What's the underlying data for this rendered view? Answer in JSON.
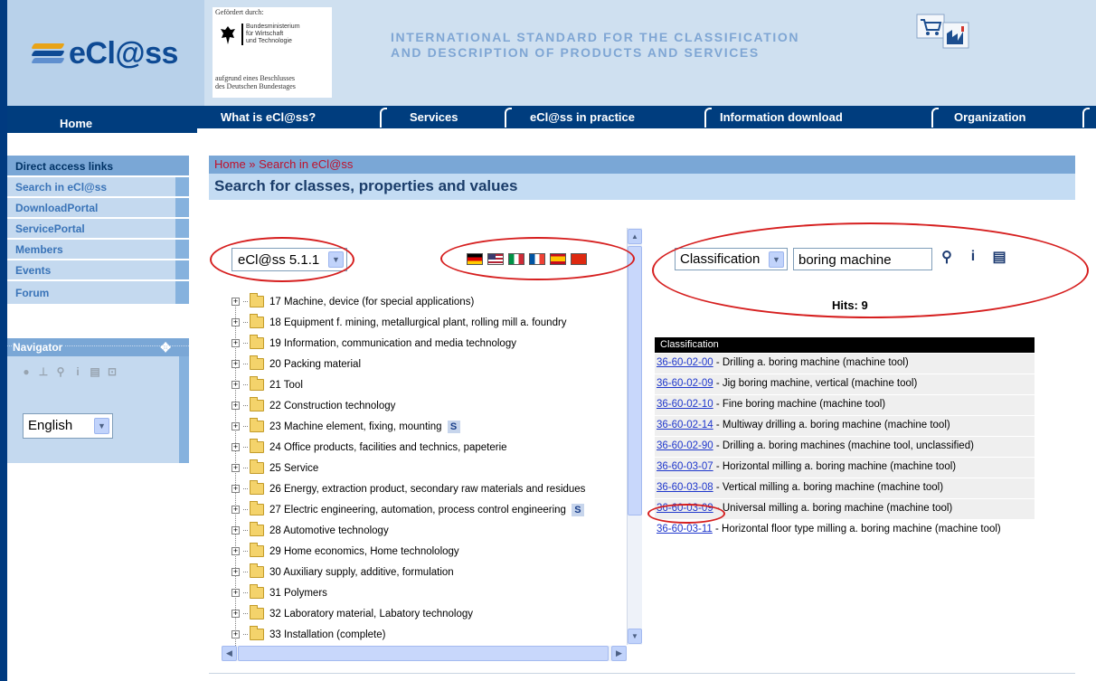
{
  "colors": {
    "nav": "#003d7e",
    "sidebar": "#c4d9ef",
    "accent": "#7aa7d6",
    "link": "#1f37cc",
    "annotation": "#d61f1f"
  },
  "header": {
    "logo": "eCl@ss",
    "sponsor": {
      "top": "Gefördert durch:",
      "ministry": [
        "Bundesministerium",
        "für Wirtschaft",
        "und Technologie"
      ],
      "bottom": [
        "aufgrund eines Beschlusses",
        "des Deutschen Bundestages"
      ]
    },
    "tagline": [
      "INTERNATIONAL STANDARD FOR THE CLASSIFICATION",
      "AND DESCRIPTION OF PRODUCTS AND SERVICES"
    ],
    "cart_icon": "shopping-cart-icon"
  },
  "nav": {
    "home": "Home",
    "items": [
      "What is eCl@ss?",
      "Services",
      "eCl@ss in practice",
      "Information download",
      "Organization"
    ]
  },
  "sidebar": {
    "heading": "Direct access links",
    "items": [
      "Search in eCl@ss",
      "DownloadPortal",
      "ServicePortal",
      "Members",
      "Events",
      "Forum"
    ],
    "navigator": {
      "title": "Navigator",
      "icons": [
        "user-icon",
        "hierarchy-icon",
        "search-icon",
        "info-icon",
        "print-icon",
        "export-icon"
      ],
      "language": "English"
    }
  },
  "main": {
    "breadcrumb": "Home » Search in eCl@ss",
    "title": "Search for classes, properties and values",
    "version": "eCl@ss 5.1.1",
    "flags": [
      "de",
      "us",
      "it",
      "fr",
      "es",
      "cn"
    ],
    "tree": [
      {
        "label": "17 Machine, device (for special applications)",
        "badge": ""
      },
      {
        "label": "18 Equipment f. mining, metallurgical plant, rolling mill a. foundry",
        "badge": ""
      },
      {
        "label": "19 Information, communication and media technology",
        "badge": ""
      },
      {
        "label": "20 Packing material",
        "badge": ""
      },
      {
        "label": "21 Tool",
        "badge": ""
      },
      {
        "label": "22 Construction technology",
        "badge": ""
      },
      {
        "label": "23 Machine element, fixing, mounting",
        "badge": "S"
      },
      {
        "label": "24 Office products, facilities and technics, papeterie",
        "badge": ""
      },
      {
        "label": "25 Service",
        "badge": ""
      },
      {
        "label": "26 Energy, extraction product, secondary raw materials and residues",
        "badge": ""
      },
      {
        "label": "27 Electric engineering, automation, process control engineering",
        "badge": "S"
      },
      {
        "label": "28 Automotive technology",
        "badge": ""
      },
      {
        "label": "29 Home economics, Home technolology",
        "badge": ""
      },
      {
        "label": "30 Auxiliary supply, additive, formulation",
        "badge": ""
      },
      {
        "label": "31 Polymers",
        "badge": ""
      },
      {
        "label": "32 Laboratory material, Labatory technology",
        "badge": ""
      },
      {
        "label": "33 Installation (complete)",
        "badge": ""
      }
    ],
    "search": {
      "type": "Classification",
      "query": "boring machine",
      "icons": [
        "search-icon",
        "info-icon",
        "print-icon"
      ]
    },
    "hits": "Hits: 9",
    "results_header": "Classification",
    "results": [
      {
        "code": "36-60-02-00",
        "text": " - Drilling a. boring machine (machine tool)"
      },
      {
        "code": "36-60-02-09",
        "text": " - Jig boring machine, vertical (machine tool)"
      },
      {
        "code": "36-60-02-10",
        "text": " - Fine boring machine (machine tool)"
      },
      {
        "code": "36-60-02-14",
        "text": " - Multiway drilling a. boring machine (machine tool)"
      },
      {
        "code": "36-60-02-90",
        "text": " - Drilling a. boring machines (machine tool, unclassified)"
      },
      {
        "code": "36-60-03-07",
        "text": " - Horizontal milling a. boring machine (machine tool)"
      },
      {
        "code": "36-60-03-08",
        "text": " - Vertical milling a. boring machine (machine tool)"
      },
      {
        "code": "36-60-03-09",
        "text": " - Universal milling a. boring machine (machine tool)"
      },
      {
        "code": "36-60-03-11",
        "text": " - Horizontal floor type milling a. boring machine (machine tool)"
      }
    ]
  }
}
